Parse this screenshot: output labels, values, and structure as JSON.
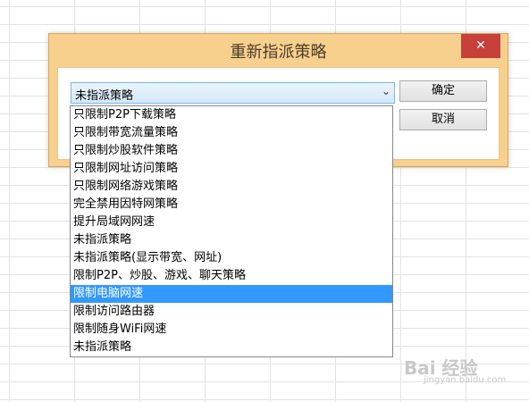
{
  "dialog": {
    "title": "重新指派策略",
    "close_label": "✕",
    "combo_value": "未指派策略",
    "ok_label": "确定",
    "cancel_label": "取消"
  },
  "dropdown": {
    "items": [
      "只限制P2P下载策略",
      "只限制带宽流量策略",
      "只限制炒股软件策略",
      "只限制网址访问策略",
      "只限制网络游戏策略",
      "完全禁用因特网策略",
      "提升局域网网速",
      "未指派策略",
      "未指派策略(显示带宽、网址)",
      "限制P2P、炒股、游戏、聊天策略",
      "限制电脑网速",
      "限制访问路由器",
      "限制随身WiFi网速",
      "未指派策略"
    ],
    "selected_index": 10
  },
  "watermark": {
    "text": "Bai 经验",
    "sub": "jingyan.baidu.com"
  },
  "colors": {
    "dialog_frame": "#f7d08e",
    "close_button": "#c7403a",
    "selection": "#3399ff"
  }
}
